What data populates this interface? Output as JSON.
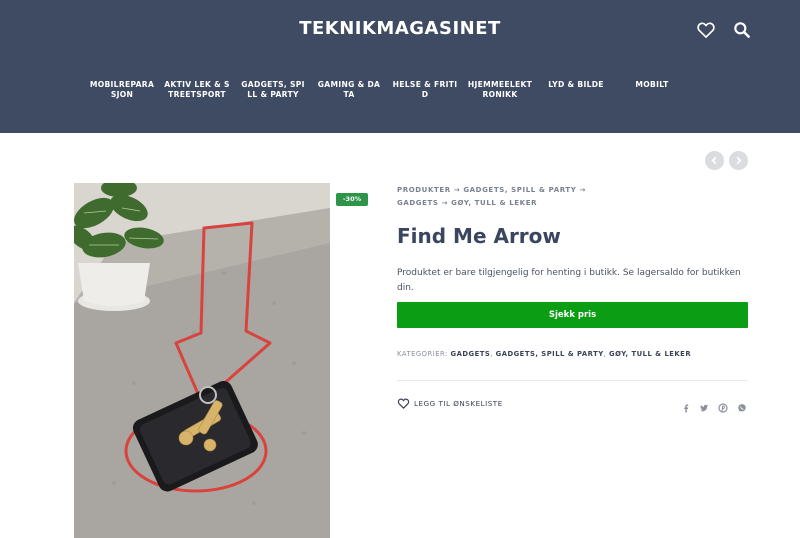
{
  "header": {
    "logo": "TEKNIKMAGASINET",
    "icons": {
      "wishlist": "heart-icon",
      "search": "search-icon"
    }
  },
  "nav": {
    "items": [
      {
        "label": "MOBILREPARASJON"
      },
      {
        "label": "AKTIV LEK & STREETSPORT"
      },
      {
        "label": "GADGETS, SPILL & PARTY"
      },
      {
        "label": "GAMING & DATA"
      },
      {
        "label": "HELSE & FRITID"
      },
      {
        "label": "HJEMMEELEKTRONIKK"
      },
      {
        "label": "LYD & BILDE"
      },
      {
        "label": "MOBILT"
      }
    ]
  },
  "pager": {
    "prev": "chevron-left-icon",
    "next": "chevron-right-icon"
  },
  "product": {
    "discount": "-30%",
    "breadcrumb": {
      "items": [
        "PRODUKTER",
        "GADGETS, SPILL & PARTY",
        "GADGETS",
        "GØY, TULL & LEKER"
      ],
      "separator": "→"
    },
    "title": "Find Me Arrow",
    "availability": "Produktet er bare tilgjengelig for henting i butikk. Se lagersaldo for butikken din.",
    "cta": "Sjekk pris",
    "categories": {
      "label": "KATEGORIER:",
      "items": [
        "GADGETS",
        "GADGETS, SPILL & PARTY",
        "GØY, TULL & LEKER"
      ],
      "separator": ","
    },
    "wishlist_label": "LEGG TIL ØNSKELISTE",
    "share_icons": [
      "facebook-icon",
      "twitter-icon",
      "pinterest-icon",
      "whatsapp-icon"
    ]
  },
  "colors": {
    "header_bg": "#3f4a63",
    "cta_green": "#0b9e14",
    "badge_green": "#2e9448",
    "title_color": "#3a4560"
  }
}
